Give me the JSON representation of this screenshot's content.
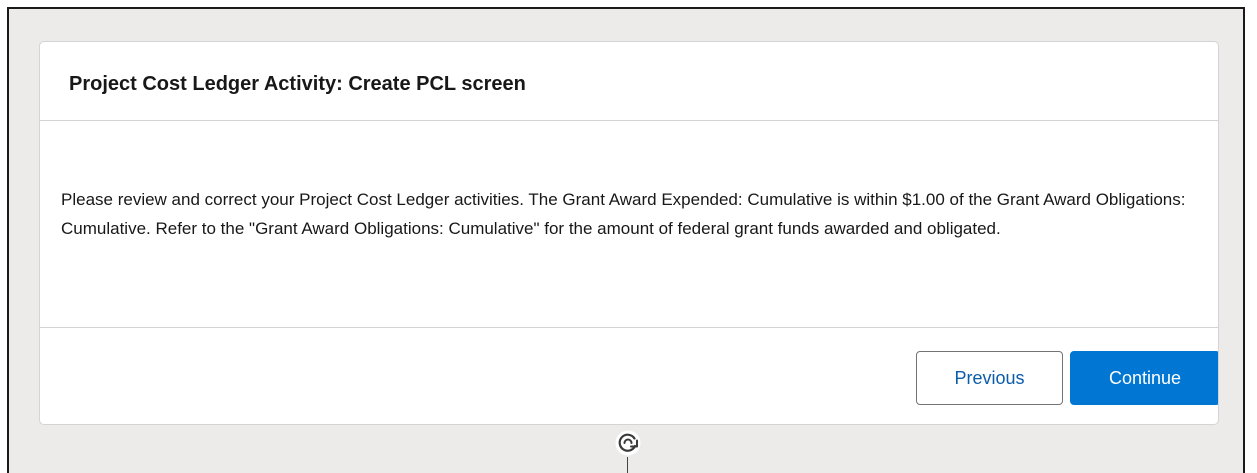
{
  "modal": {
    "title": "Project Cost Ledger Activity: Create PCL screen",
    "message": "Please review and correct your Project Cost Ledger activities. The Grant Award Expended: Cumulative is within $1.00 of the Grant Award Obligations: Cumulative. Refer to the \"Grant Award Obligations: Cumulative\" for the amount of federal grant funds awarded and obligated.",
    "previous_label": "Previous",
    "continue_label": "Continue"
  },
  "flow": {
    "connector_icon": "loop-arrow-icon"
  },
  "colors": {
    "background": "#ecebea",
    "card": "#ffffff",
    "accent": "#0176d3",
    "link": "#0b5cab",
    "text": "#181818"
  }
}
